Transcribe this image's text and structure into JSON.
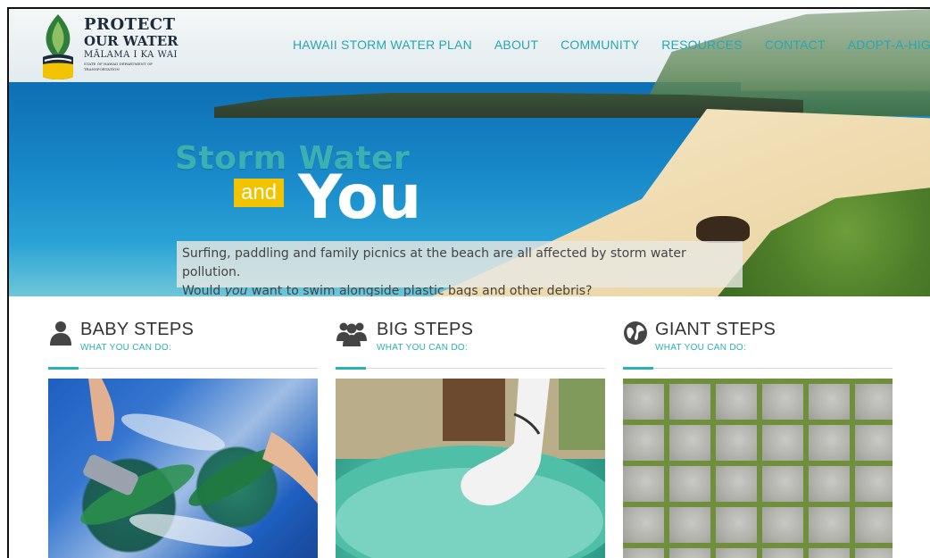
{
  "brand": {
    "line1": "PROTECT",
    "line2": "OUR WATER",
    "line3": "MĀLAMA I KA WAI",
    "line4": "STATE OF HAWAII DEPARTMENT OF TRANSPORTATION",
    "colors": {
      "teal": "#2ab0b8",
      "yellow": "#f2c300",
      "navy": "#1d2b3a"
    }
  },
  "nav": {
    "items": [
      "HAWAII STORM WATER PLAN",
      "ABOUT",
      "COMMUNITY",
      "RESOURCES",
      "CONTACT",
      "ADOPT-A-HIGHWAY"
    ]
  },
  "hero": {
    "headline1": "Storm Water",
    "and": "and",
    "you": "You",
    "caption_line1": "Surfing, paddling and family picnics at the beach are all affected by storm water pollution.",
    "caption_line2_a": "Would ",
    "caption_line2_em": "you",
    "caption_line2_b": " want to swim alongside plastic bags and other debris?"
  },
  "steps": [
    {
      "title": "BABY STEPS",
      "subtitle": "WHAT YOU CAN DO:",
      "icon": "person-icon"
    },
    {
      "title": "BIG STEPS",
      "subtitle": "WHAT YOU CAN DO:",
      "icon": "group-icon"
    },
    {
      "title": "GIANT STEPS",
      "subtitle": "WHAT YOU CAN DO:",
      "icon": "globe-icon"
    }
  ]
}
